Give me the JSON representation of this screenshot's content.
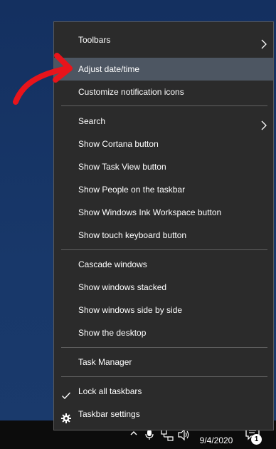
{
  "context_menu": {
    "items": [
      {
        "label": "Toolbars",
        "has_submenu": true,
        "icon": "chevron-right-icon"
      },
      {
        "label": "Adjust date/time",
        "highlighted": true
      },
      {
        "label": "Customize notification icons"
      },
      {
        "label": "Search",
        "has_submenu": true,
        "icon": "chevron-right-icon"
      },
      {
        "label": "Show Cortana button"
      },
      {
        "label": "Show Task View button"
      },
      {
        "label": "Show People on the taskbar"
      },
      {
        "label": "Show Windows Ink Workspace button"
      },
      {
        "label": "Show touch keyboard button"
      },
      {
        "label": "Cascade windows"
      },
      {
        "label": "Show windows stacked"
      },
      {
        "label": "Show windows side by side"
      },
      {
        "label": "Show the desktop"
      },
      {
        "label": "Task Manager"
      },
      {
        "label": "Lock all taskbars",
        "checked": true,
        "icon": "checkmark-icon"
      },
      {
        "label": "Taskbar settings",
        "icon": "gear-icon"
      }
    ]
  },
  "taskbar": {
    "date": "9/4/2020",
    "notification_count": "1",
    "tray_icons": [
      "chevron-up-icon",
      "microphone-icon",
      "network-icon",
      "volume-icon",
      "notification-icon"
    ]
  },
  "annotation": {
    "color": "#e8141b",
    "icon": "red-arrow-icon"
  },
  "colors": {
    "menu_background": "#2b2b2b",
    "highlight": "#4d5662",
    "separator": "#606060",
    "text": "#ffffff",
    "desktop": "#17325c",
    "taskbar": "#0c0c0c"
  }
}
